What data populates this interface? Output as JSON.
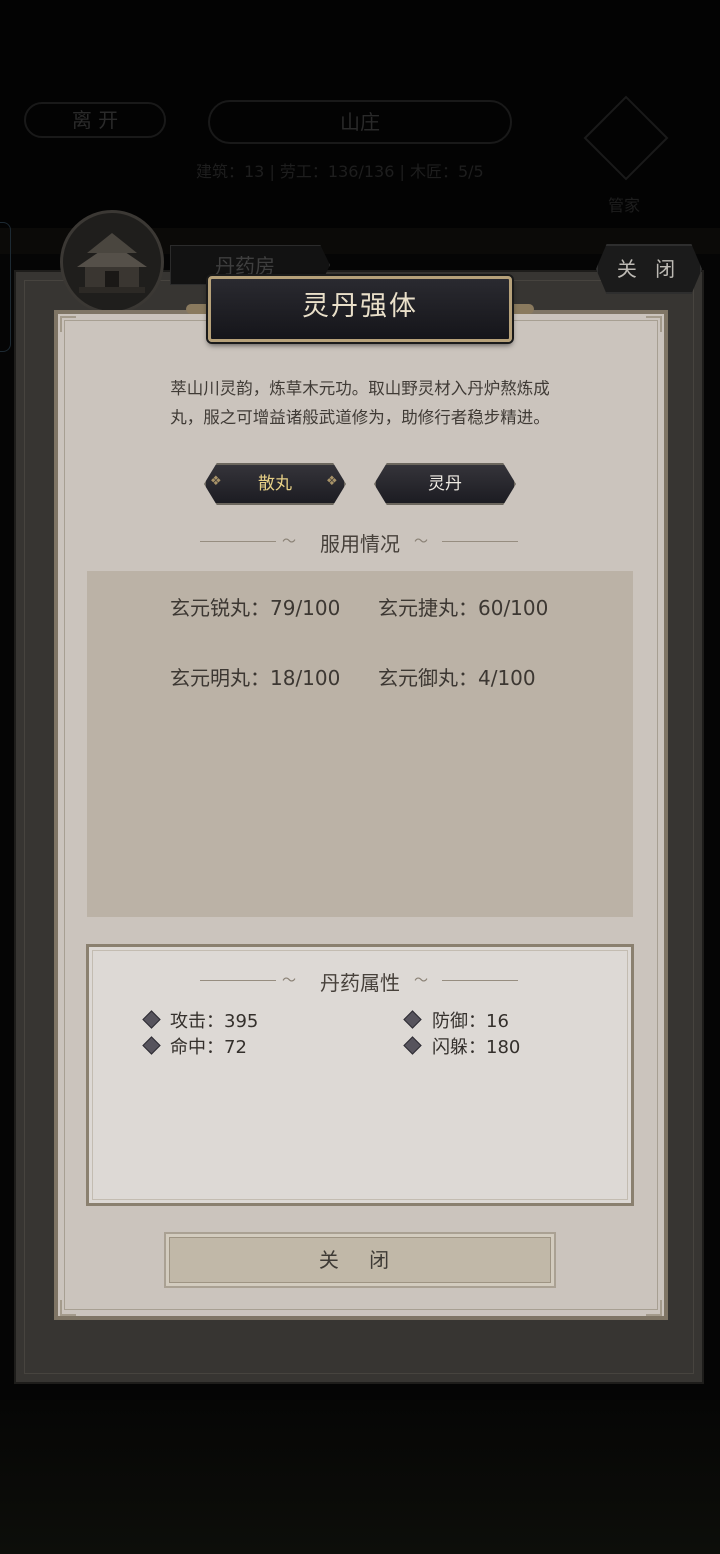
{
  "background": {
    "leave_button": "离 开",
    "manor_title": "山庄",
    "stats": "建筑：13  |  劳工：136/136  |  木匠：5/5",
    "steward_label": "管家",
    "building_tab": "丹药房",
    "top_close_button": "关 闭"
  },
  "dialog": {
    "title": "灵丹强体",
    "description_line1": "萃山川灵韵，炼草木元功。取山野灵材入丹炉熬炼成",
    "description_line2": "丸，服之可增益诸般武道修为，助修行者稳步精进。",
    "tabs": [
      {
        "label": "散丸",
        "selected": true
      },
      {
        "label": "灵丹",
        "selected": false
      }
    ],
    "usage_section_title": "服用情况",
    "usage_items": [
      "玄元锐丸：79/100",
      "玄元捷丸：60/100",
      "玄元明丸：18/100",
      "玄元御丸：4/100"
    ],
    "attr_section_title": "丹药属性",
    "attributes": [
      "攻击：395",
      "防御：16",
      "命中：72",
      "闪躲：180"
    ],
    "close_button": "关 闭"
  },
  "colors": {
    "panel": "#cbc4bd",
    "usage_box": "#bbb2a6",
    "attr_box": "#ddd9d5",
    "title_plate": "#1c1c22",
    "title_text": "#e9dfc9",
    "selected_tab_text": "#e6cf86",
    "tab_text": "#f0ece4"
  },
  "icons": [
    "building-icon",
    "diamond-bullet-icon",
    "steward-icon"
  ]
}
